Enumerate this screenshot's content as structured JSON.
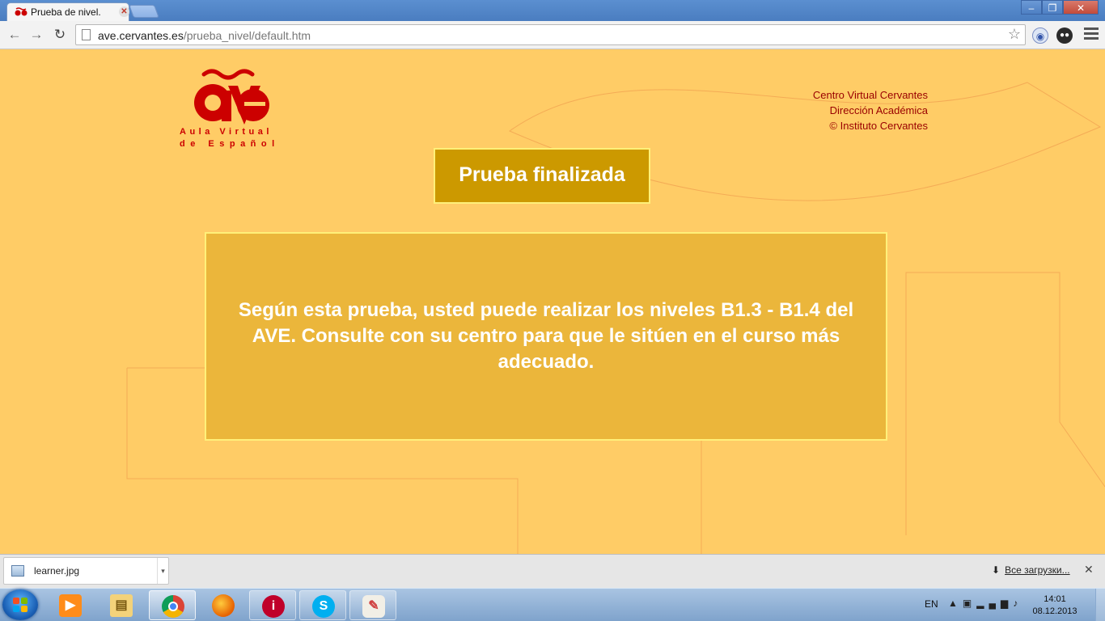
{
  "browser": {
    "tab_title": "Prueba de nivel.",
    "tab_close_glyph": "✕",
    "url_host": "ave.cervantes.es",
    "url_path": "/prueba_nivel/default.htm",
    "window_controls": [
      "–",
      "❐",
      "✕"
    ],
    "back_glyph": "←",
    "forward_glyph": "→",
    "reload_glyph": "↻",
    "star_glyph": "☆"
  },
  "site": {
    "logo_text": "ave",
    "logo_line1": "Aula Virtual",
    "logo_line2": "de Español",
    "credits": [
      "Centro Virtual Cervantes",
      "Dirección Académica",
      "© Instituto Cervantes"
    ],
    "status_title": "Prueba finalizada",
    "result_message": "Según esta prueba, usted puede realizar los niveles B1.3 - B1.4 del AVE. Consulte con su centro para que le sitúen en el curso más adecuado."
  },
  "downloads": {
    "file_name": "learner.jpg",
    "dropdown_glyph": "▾",
    "all_downloads_label": "Все загрузки...",
    "close_glyph": "✕"
  },
  "taskbar": {
    "language": "EN",
    "time": "14:01",
    "date": "08.12.2013"
  },
  "colors": {
    "page_background": "#ffcc66",
    "title_box": "#cc9900",
    "result_box": "#ebb63b",
    "box_border": "#fff07a",
    "brand_red": "#cc0000"
  }
}
